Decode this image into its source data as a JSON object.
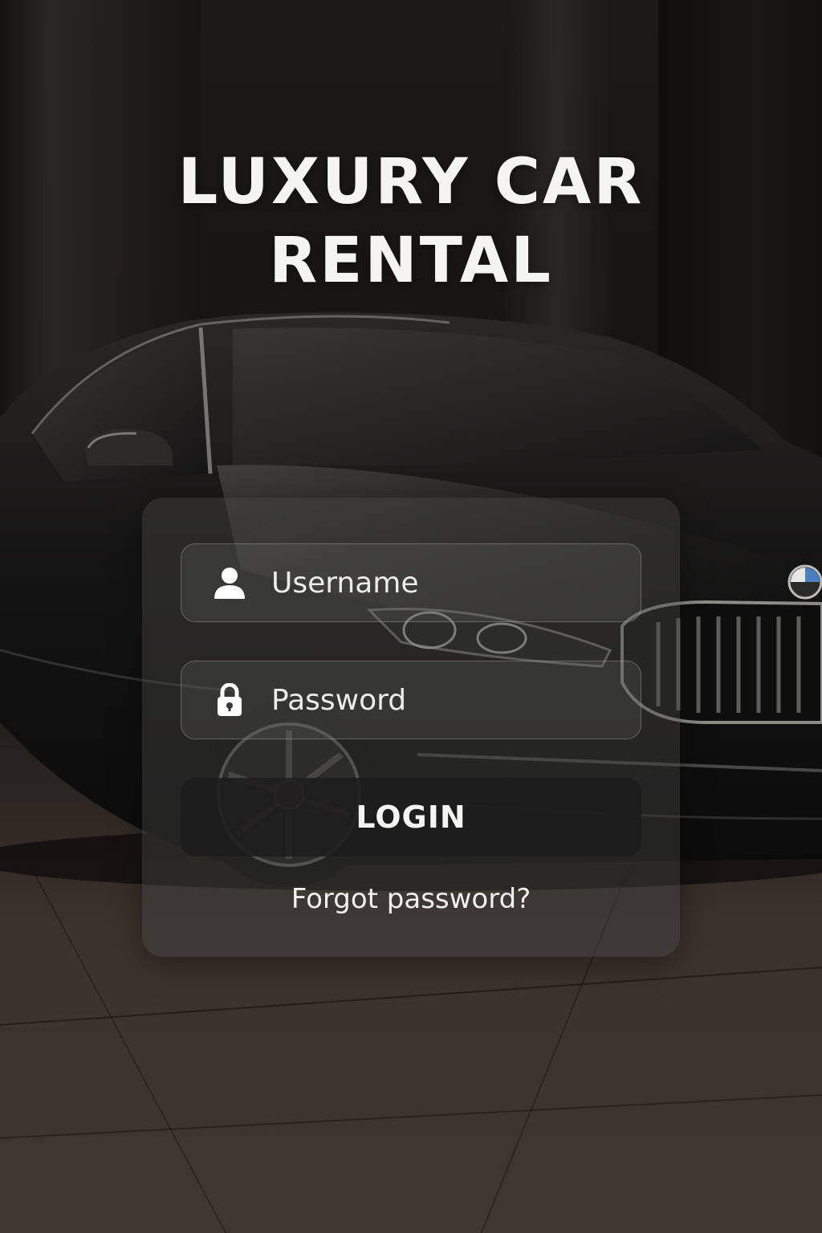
{
  "app": {
    "title": "LUXURY CAR\nRENTAL"
  },
  "login": {
    "username_placeholder": "Username",
    "password_placeholder": "Password",
    "login_label": "LOGIN",
    "forgot_label": "Forgot password?"
  },
  "icons": {
    "username": "user-icon",
    "password": "lock-icon"
  },
  "colors": {
    "text": "#f4f4f2",
    "card": "#464442",
    "button": "#1e1d1c",
    "background": "#131211"
  }
}
